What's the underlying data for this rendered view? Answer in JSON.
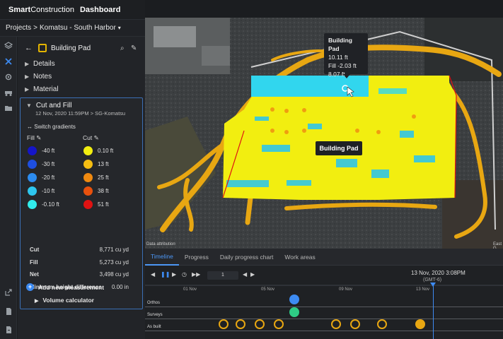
{
  "header": {
    "brand_bold": "Smart",
    "brand_light": "Construction",
    "app": "Dashboard"
  },
  "breadcrumb": {
    "root": "Projects",
    "sep": ">",
    "project": "Komatsu - South Harbor",
    "chevron": "▾"
  },
  "rail_icons": [
    "layers-icon",
    "tools-icon",
    "settings-icon",
    "machine-icon",
    "folder-icon",
    "export-icon",
    "file-icon",
    "report-icon"
  ],
  "panel": {
    "title": "Building Pad",
    "sections": [
      "Details",
      "Notes",
      "Material"
    ],
    "cut_fill": {
      "title": "Cut and Fill",
      "subtitle": "12 Nov, 2020 11:59PM > SG-Komatsu",
      "switch_label": "Switch gradients",
      "fill_header": "Fill",
      "cut_header": "Cut",
      "fill_gradients": [
        {
          "label": "-40 ft",
          "color": "#1515c8"
        },
        {
          "label": "-30 ft",
          "color": "#1e4fe0"
        },
        {
          "label": "-20 ft",
          "color": "#2c8cf0"
        },
        {
          "label": "-10 ft",
          "color": "#2ec6ee"
        },
        {
          "label": "-0.10 ft",
          "color": "#31ecec"
        }
      ],
      "cut_gradients": [
        {
          "label": "0.10 ft",
          "color": "#f2ee10"
        },
        {
          "label": "13 ft",
          "color": "#f5bd12"
        },
        {
          "label": "25 ft",
          "color": "#f08a10"
        },
        {
          "label": "38 ft",
          "color": "#e8510d"
        },
        {
          "label": "51 ft",
          "color": "#e01212"
        }
      ],
      "stats": [
        {
          "key": "Cut",
          "value": "8,771 cu yd"
        },
        {
          "key": "Fill",
          "value": "5,273 cu yd"
        },
        {
          "key": "Net",
          "value": "3,498 cu yd"
        },
        {
          "key": "Minimum height difference",
          "value": "0.00 in"
        }
      ],
      "volume_calc": "Volume calculator"
    },
    "add_measurement": "Add new measurement"
  },
  "map": {
    "tooltip": {
      "title": "Building Pad",
      "line1": "10.11 ft",
      "line2": "Fill -2.03 ft",
      "line3": "8.07 ft"
    },
    "label": "Building Pad",
    "attribution": "Data attribution",
    "east": "East G"
  },
  "tabs": [
    "Timeline",
    "Progress",
    "Daily progress chart",
    "Work areas"
  ],
  "timeline": {
    "current_date": "13 Nov, 2020 3:08PM",
    "timezone": "(GMT-6)",
    "page": "1",
    "ticks": [
      "01 Nov",
      "05 Nov",
      "09 Nov",
      "13 Nov"
    ],
    "rows": [
      "Orthos",
      "Surveys",
      "As built"
    ]
  },
  "colors": {
    "accent": "#3d8bf2",
    "cut": "#f2ee10",
    "fill": "#31ecec",
    "asbuilt": "#e8a712",
    "ortho": "#3d8bf2",
    "survey": "#2ecc85"
  }
}
